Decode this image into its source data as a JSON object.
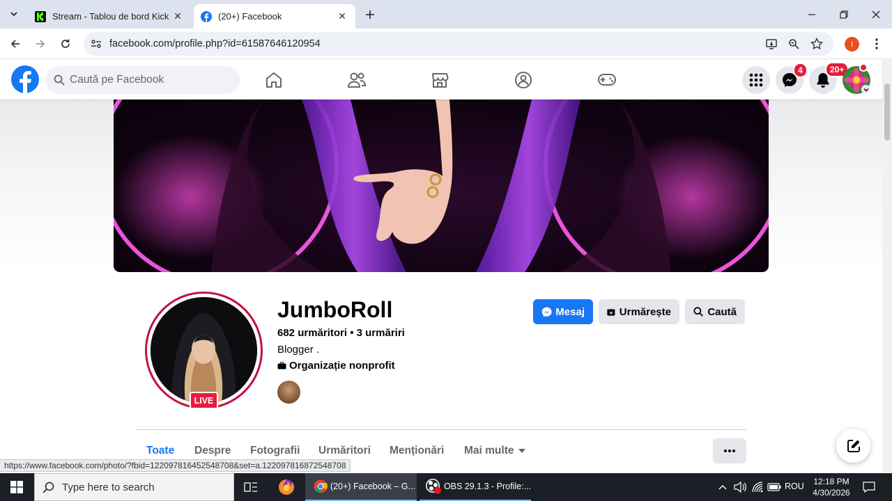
{
  "browser": {
    "tabs": [
      {
        "title": "Stream - Tablou de bord Kick",
        "active": false
      },
      {
        "title": "(20+) Facebook",
        "active": true
      }
    ],
    "url": "facebook.com/profile.php?id=61587646120954",
    "profile_initial": "I",
    "status_url": "https://www.facebook.com/photo/?fbid=122097816452548708&set=a.122097816872548708"
  },
  "facebook": {
    "search_placeholder": "Caută pe Facebook",
    "messenger_badge": "4",
    "notifications_badge": "20+",
    "brand_color": "#1877f2"
  },
  "profile": {
    "name": "JumboRoll",
    "stats": "682 urmăritori • 3 urmăriri",
    "category": "Blogger .",
    "org": "Organizație nonprofit",
    "live_label": "LIVE",
    "buttons": {
      "message": "Mesaj",
      "follow": "Urmărește",
      "search": "Caută"
    },
    "tabs": [
      "Toate",
      "Despre",
      "Fotografii",
      "Urmăritori",
      "Menționări",
      "Mai multe"
    ],
    "active_tab": "Toate"
  },
  "taskbar": {
    "search_placeholder": "Type here to search",
    "apps": [
      {
        "label": "(20+) Facebook – G...",
        "active": true
      },
      {
        "label": "OBS 29.1.3 - Profile:...",
        "active": false
      }
    ],
    "language": "ROU",
    "time": "12:18 PM",
    "date": "4/30/2026"
  }
}
